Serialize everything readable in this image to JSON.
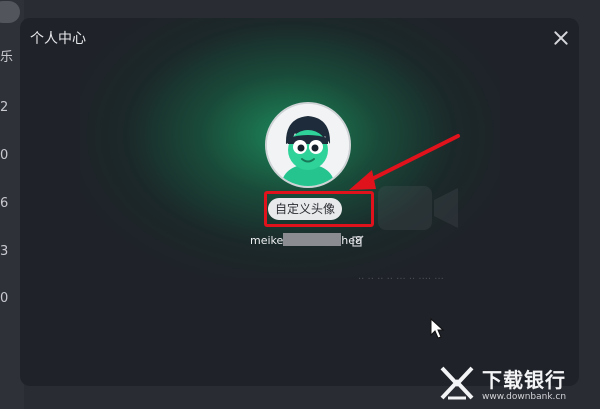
{
  "background_app": {
    "sidebar_numbers": [
      "2",
      "0",
      "6",
      "3",
      "0"
    ],
    "partial_char": "乐"
  },
  "dialog": {
    "title": "个人中心",
    "custom_avatar_label": "自定义头像",
    "username_prefix": "meike",
    "username_suffix": "he8",
    "ghost_text": "·· ·· ·· ·· ··· ·· ···· ···"
  },
  "watermark": {
    "title": "下载银行",
    "url": "www.downbank.cn"
  },
  "colors": {
    "highlight": "#e0121b",
    "avatar_green": "#2fd39a"
  },
  "icons": {
    "close": "close-icon",
    "edit": "edit-icon",
    "cursor": "mouse-cursor-icon",
    "arrow": "annotation-arrow"
  }
}
